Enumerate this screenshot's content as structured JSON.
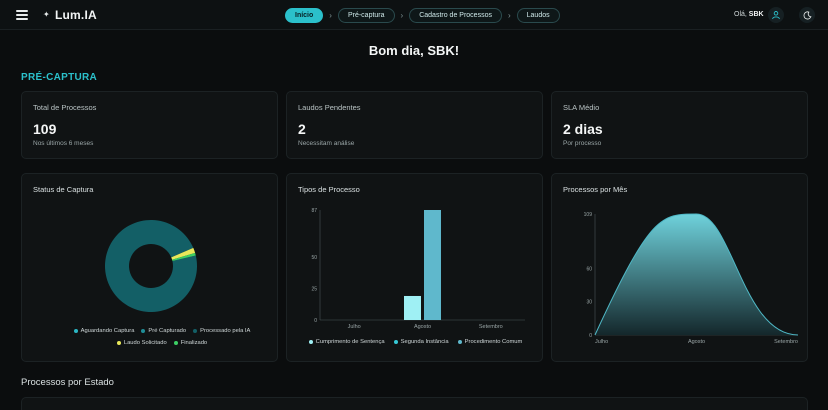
{
  "header": {
    "app_name": "Lum.IA",
    "breadcrumbs": [
      "Início",
      "Pré-captura",
      "Cadastro de Processos",
      "Laudos"
    ],
    "greeting_prefix": "Olá,",
    "user": "SBK"
  },
  "page": {
    "title": "Bom dia, SBK!",
    "section": "PRÉ-CAPTURA"
  },
  "stats": [
    {
      "label": "Total de Processos",
      "value": "109",
      "sub": "Nos últimos 6 meses"
    },
    {
      "label": "Laudos Pendentes",
      "value": "2",
      "sub": "Necessitam análise"
    },
    {
      "label": "SLA Médio",
      "value": "2 dias",
      "sub": "Por processo"
    }
  ],
  "charts": {
    "status_title": "Status de Captura",
    "tipos_title": "Tipos de Processo",
    "mes_title": "Processos por Mês"
  },
  "legends": {
    "status": [
      {
        "label": "Aguardando Captura",
        "color": "#2bb7c4"
      },
      {
        "label": "Pré Capturado",
        "color": "#1f8d97"
      },
      {
        "label": "Processado pela IA",
        "color": "#135f66"
      },
      {
        "label": "Laudo Solicitado",
        "color": "#e8e85a"
      },
      {
        "label": "Finalizado",
        "color": "#3ccf64"
      }
    ],
    "tipos": [
      {
        "label": "Cumprimento de Sentença",
        "color": "#9ff0f4"
      },
      {
        "label": "Segunda Instância",
        "color": "#36c9d6"
      },
      {
        "label": "Procedimento Comum",
        "color": "#5fb8cc"
      }
    ]
  },
  "chart_data": [
    {
      "type": "pie",
      "title": "Status de Captura",
      "categories": [
        "Aguardando Captura",
        "Pré Capturado",
        "Processado pela IA",
        "Laudo Solicitado",
        "Finalizado"
      ],
      "values": [
        0,
        0,
        106,
        2,
        1
      ],
      "donut": true,
      "legend": "bottom"
    },
    {
      "type": "bar",
      "title": "Tipos de Processo",
      "categories": [
        "Julho",
        "Agosto",
        "Setembro"
      ],
      "series": [
        {
          "name": "Cumprimento de Sentença",
          "values": [
            0,
            19,
            0
          ]
        },
        {
          "name": "Segunda Instância",
          "values": [
            0,
            0,
            0
          ]
        },
        {
          "name": "Procedimento Comum",
          "values": [
            0,
            87,
            0
          ]
        }
      ],
      "yticks": [
        0,
        25,
        50,
        87
      ],
      "ylim": [
        0,
        87
      ],
      "legend": "bottom"
    },
    {
      "type": "area",
      "title": "Processos por Mês",
      "categories": [
        "Julho",
        "Agosto",
        "Setembro"
      ],
      "values": [
        0,
        109,
        0
      ],
      "yticks": [
        0,
        30,
        60,
        109
      ],
      "ylim": [
        0,
        109
      ]
    }
  ],
  "bottom": {
    "title": "Processos por Estado"
  }
}
